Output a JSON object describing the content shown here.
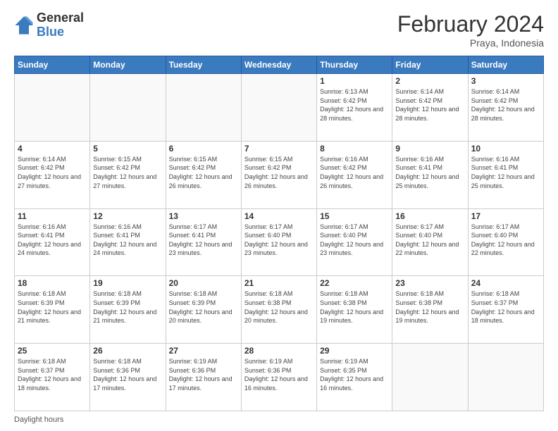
{
  "header": {
    "logo_general": "General",
    "logo_blue": "Blue",
    "month_title": "February 2024",
    "location": "Praya, Indonesia"
  },
  "days_of_week": [
    "Sunday",
    "Monday",
    "Tuesday",
    "Wednesday",
    "Thursday",
    "Friday",
    "Saturday"
  ],
  "footer_label": "Daylight hours",
  "weeks": [
    [
      {
        "day": "",
        "sunrise": "",
        "sunset": "",
        "daylight": "",
        "empty": true
      },
      {
        "day": "",
        "sunrise": "",
        "sunset": "",
        "daylight": "",
        "empty": true
      },
      {
        "day": "",
        "sunrise": "",
        "sunset": "",
        "daylight": "",
        "empty": true
      },
      {
        "day": "",
        "sunrise": "",
        "sunset": "",
        "daylight": "",
        "empty": true
      },
      {
        "day": "1",
        "sunrise": "6:13 AM",
        "sunset": "6:42 PM",
        "daylight": "12 hours and 28 minutes."
      },
      {
        "day": "2",
        "sunrise": "6:14 AM",
        "sunset": "6:42 PM",
        "daylight": "12 hours and 28 minutes."
      },
      {
        "day": "3",
        "sunrise": "6:14 AM",
        "sunset": "6:42 PM",
        "daylight": "12 hours and 28 minutes."
      }
    ],
    [
      {
        "day": "4",
        "sunrise": "6:14 AM",
        "sunset": "6:42 PM",
        "daylight": "12 hours and 27 minutes."
      },
      {
        "day": "5",
        "sunrise": "6:15 AM",
        "sunset": "6:42 PM",
        "daylight": "12 hours and 27 minutes."
      },
      {
        "day": "6",
        "sunrise": "6:15 AM",
        "sunset": "6:42 PM",
        "daylight": "12 hours and 26 minutes."
      },
      {
        "day": "7",
        "sunrise": "6:15 AM",
        "sunset": "6:42 PM",
        "daylight": "12 hours and 26 minutes."
      },
      {
        "day": "8",
        "sunrise": "6:16 AM",
        "sunset": "6:42 PM",
        "daylight": "12 hours and 26 minutes."
      },
      {
        "day": "9",
        "sunrise": "6:16 AM",
        "sunset": "6:41 PM",
        "daylight": "12 hours and 25 minutes."
      },
      {
        "day": "10",
        "sunrise": "6:16 AM",
        "sunset": "6:41 PM",
        "daylight": "12 hours and 25 minutes."
      }
    ],
    [
      {
        "day": "11",
        "sunrise": "6:16 AM",
        "sunset": "6:41 PM",
        "daylight": "12 hours and 24 minutes."
      },
      {
        "day": "12",
        "sunrise": "6:16 AM",
        "sunset": "6:41 PM",
        "daylight": "12 hours and 24 minutes."
      },
      {
        "day": "13",
        "sunrise": "6:17 AM",
        "sunset": "6:41 PM",
        "daylight": "12 hours and 23 minutes."
      },
      {
        "day": "14",
        "sunrise": "6:17 AM",
        "sunset": "6:40 PM",
        "daylight": "12 hours and 23 minutes."
      },
      {
        "day": "15",
        "sunrise": "6:17 AM",
        "sunset": "6:40 PM",
        "daylight": "12 hours and 23 minutes."
      },
      {
        "day": "16",
        "sunrise": "6:17 AM",
        "sunset": "6:40 PM",
        "daylight": "12 hours and 22 minutes."
      },
      {
        "day": "17",
        "sunrise": "6:17 AM",
        "sunset": "6:40 PM",
        "daylight": "12 hours and 22 minutes."
      }
    ],
    [
      {
        "day": "18",
        "sunrise": "6:18 AM",
        "sunset": "6:39 PM",
        "daylight": "12 hours and 21 minutes."
      },
      {
        "day": "19",
        "sunrise": "6:18 AM",
        "sunset": "6:39 PM",
        "daylight": "12 hours and 21 minutes."
      },
      {
        "day": "20",
        "sunrise": "6:18 AM",
        "sunset": "6:39 PM",
        "daylight": "12 hours and 20 minutes."
      },
      {
        "day": "21",
        "sunrise": "6:18 AM",
        "sunset": "6:38 PM",
        "daylight": "12 hours and 20 minutes."
      },
      {
        "day": "22",
        "sunrise": "6:18 AM",
        "sunset": "6:38 PM",
        "daylight": "12 hours and 19 minutes."
      },
      {
        "day": "23",
        "sunrise": "6:18 AM",
        "sunset": "6:38 PM",
        "daylight": "12 hours and 19 minutes."
      },
      {
        "day": "24",
        "sunrise": "6:18 AM",
        "sunset": "6:37 PM",
        "daylight": "12 hours and 18 minutes."
      }
    ],
    [
      {
        "day": "25",
        "sunrise": "6:18 AM",
        "sunset": "6:37 PM",
        "daylight": "12 hours and 18 minutes."
      },
      {
        "day": "26",
        "sunrise": "6:18 AM",
        "sunset": "6:36 PM",
        "daylight": "12 hours and 17 minutes."
      },
      {
        "day": "27",
        "sunrise": "6:19 AM",
        "sunset": "6:36 PM",
        "daylight": "12 hours and 17 minutes."
      },
      {
        "day": "28",
        "sunrise": "6:19 AM",
        "sunset": "6:36 PM",
        "daylight": "12 hours and 16 minutes."
      },
      {
        "day": "29",
        "sunrise": "6:19 AM",
        "sunset": "6:35 PM",
        "daylight": "12 hours and 16 minutes."
      },
      {
        "day": "",
        "sunrise": "",
        "sunset": "",
        "daylight": "",
        "empty": true
      },
      {
        "day": "",
        "sunrise": "",
        "sunset": "",
        "daylight": "",
        "empty": true
      }
    ]
  ]
}
